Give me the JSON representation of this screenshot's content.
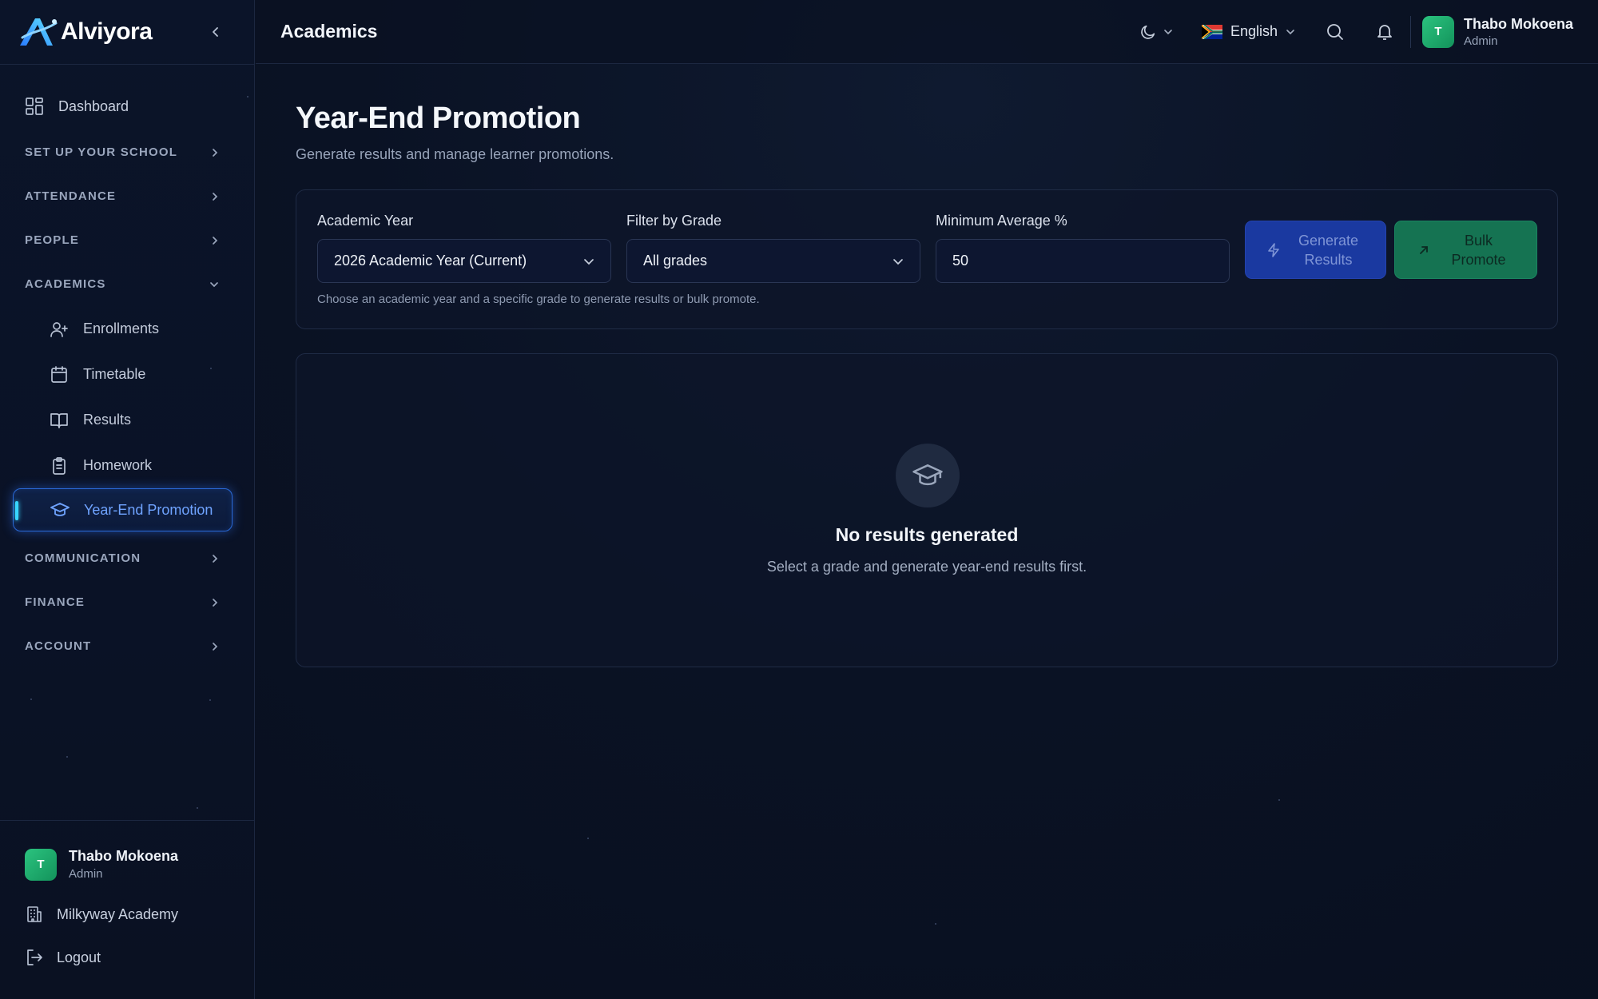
{
  "brand": {
    "name": "Alviyora"
  },
  "sidebar": {
    "dashboard": "Dashboard",
    "sections": {
      "setup": "SET UP YOUR SCHOOL",
      "attendance": "ATTENDANCE",
      "people": "PEOPLE",
      "academics": "ACADEMICS",
      "communication": "COMMUNICATION",
      "finance": "FINANCE",
      "account": "ACCOUNT"
    },
    "academics_items": [
      "Enrollments",
      "Timetable",
      "Results",
      "Homework",
      "Year-End Promotion"
    ],
    "active_item": "Year-End Promotion"
  },
  "user": {
    "initial": "T",
    "name": "Thabo Mokoena",
    "role": "Admin"
  },
  "footer": {
    "school": "Milkyway Academy",
    "logout": "Logout"
  },
  "header": {
    "title": "Academics",
    "language": "English"
  },
  "page": {
    "title": "Year-End Promotion",
    "subtitle": "Generate results and manage learner promotions."
  },
  "filters": {
    "academic_year": {
      "label": "Academic Year",
      "value": "2026 Academic Year (Current)"
    },
    "grade": {
      "label": "Filter by Grade",
      "value": "All grades"
    },
    "min_average": {
      "label": "Minimum Average %",
      "value": "50"
    },
    "helper": "Choose an academic year and a specific grade to generate results or bulk promote.",
    "generate_label": "Generate Results",
    "bulk_label": "Bulk Promote"
  },
  "empty_state": {
    "title": "No results generated",
    "message": "Select a grade and generate year-end results first."
  },
  "colors": {
    "accent": "#2a6ad8",
    "active_text": "#6fa3ff",
    "generate_bg": "#1a39a0",
    "bulk_bg": "#157352",
    "avatar": "#1fa96a"
  }
}
